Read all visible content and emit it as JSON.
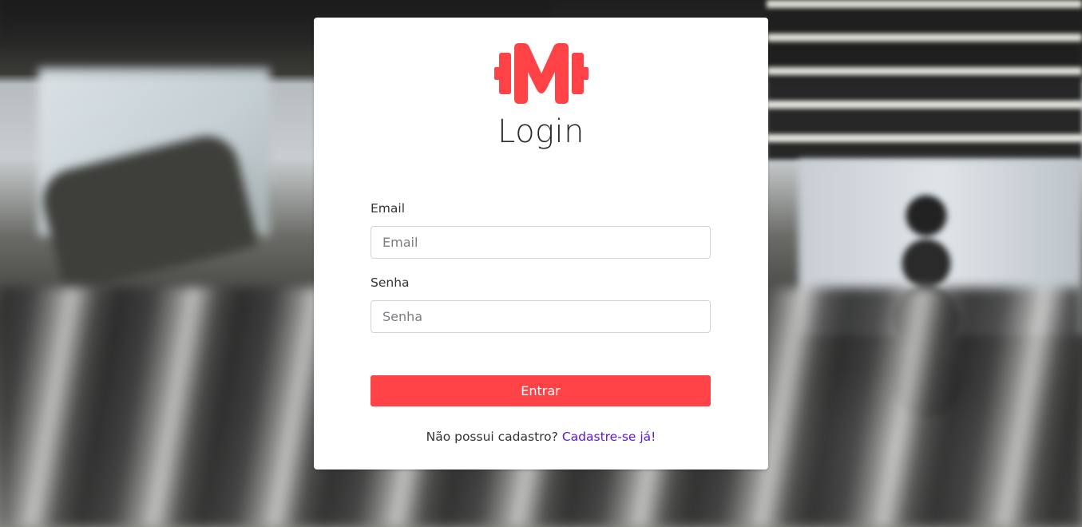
{
  "colors": {
    "accent": "#ff4245",
    "link": "#5b16d6",
    "card_background": "#ffffff"
  },
  "logo": {
    "icon": "dumbbell-m-logo-icon",
    "color": "#ff4245"
  },
  "login": {
    "title": "Login",
    "email": {
      "label": "Email",
      "placeholder": "Email",
      "value": ""
    },
    "password": {
      "label": "Senha",
      "placeholder": "Senha",
      "value": ""
    },
    "submit_label": "Entrar",
    "signup_prompt": "Não possui cadastro?",
    "signup_link": "Cadastre-se já!"
  }
}
